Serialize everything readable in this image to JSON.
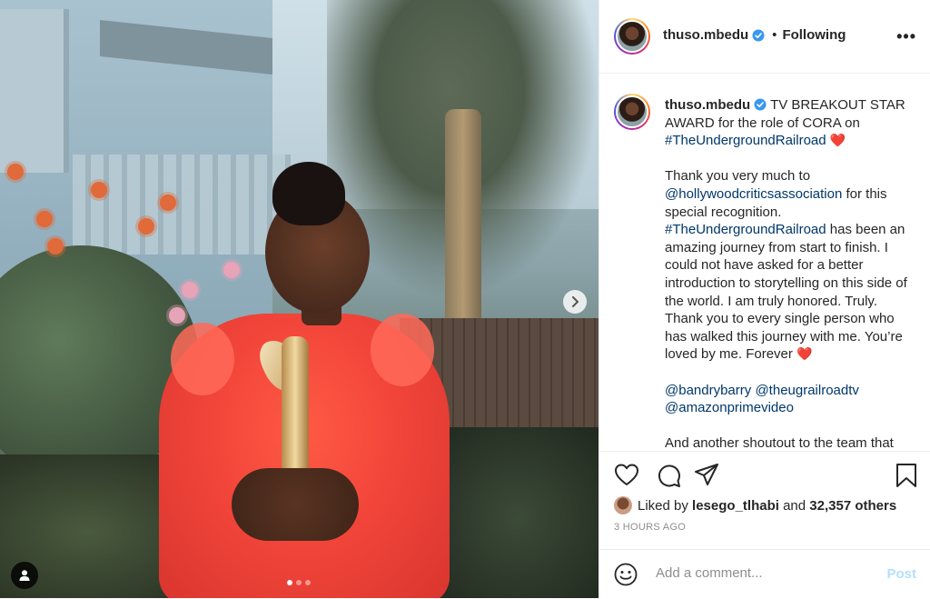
{
  "post": {
    "username": "thuso.mbedu",
    "header_separator": "•",
    "follow_status": "Following",
    "more_label": "•••",
    "carousel": {
      "slide_count": 3,
      "active_index": 0
    },
    "next_icon": "chevron-right-icon",
    "tag_icon": "user-tag-icon"
  },
  "caption": {
    "username": "thuso.mbedu",
    "line1_text": "TV BREAKOUT STAR AWARD for the role of CORA on",
    "hashtag1": "#TheUndergroundRailroad",
    "heart": "❤️",
    "thanks_intro": "Thank you very much to",
    "mention_hca": "@hollywoodcriticsassociation",
    "thanks_rest": "for this special recognition.",
    "hashtag2": "#TheUndergroundRailroad",
    "body_text": "has been an amazing journey from start to finish. I could not have asked for a better introduction to storytelling on this side of the world. I am truly honored. Truly. Thank you to every single person who has walked this journey with me. You’re loved by me. Forever",
    "mention1": "@bandrybarry",
    "mention2": "@theugrailroadtv",
    "mention3": "@amazonprimevideo",
    "cut_text": "And another shoutout to the team that"
  },
  "likes": {
    "prefix": "Liked by",
    "user": "lesego_tlhabi",
    "and": "and",
    "others": "32,357 others"
  },
  "timestamp": "3 HOURS AGO",
  "comment": {
    "placeholder": "Add a comment...",
    "post_label": "Post"
  },
  "colors": {
    "link": "#00376b",
    "verified": "#3897f0",
    "post_disabled": "#b2dffc"
  }
}
